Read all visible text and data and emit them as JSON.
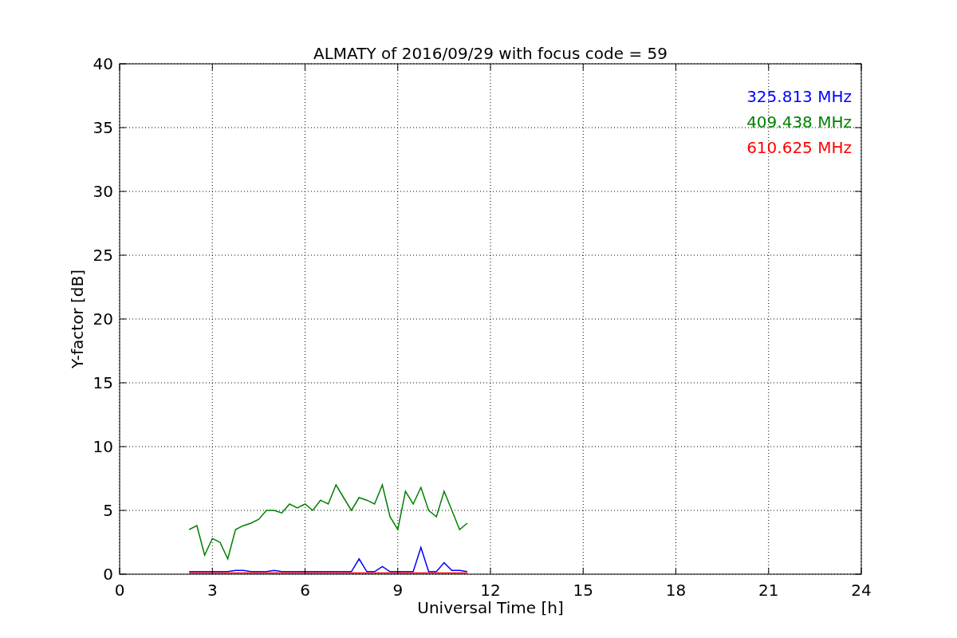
{
  "chart_data": {
    "type": "line",
    "title": "ALMATY of 2016/09/29 with focus code = 59",
    "xlabel": "Universal Time [h]",
    "ylabel": "Y-factor [dB]",
    "x": [
      2.25,
      2.5,
      2.75,
      3,
      3.25,
      3.5,
      3.75,
      4,
      4.25,
      4.5,
      4.75,
      5,
      5.25,
      5.5,
      5.75,
      6,
      6.25,
      6.5,
      6.75,
      7,
      7.25,
      7.5,
      7.75,
      8,
      8.25,
      8.5,
      8.75,
      9,
      9.25,
      9.5,
      9.75,
      10,
      10.25,
      10.5,
      10.75,
      11,
      11.25
    ],
    "series": [
      {
        "name": "325.813 MHz",
        "color": "#0000ff",
        "values": [
          0.2,
          0.2,
          0.2,
          0.2,
          0.2,
          0.2,
          0.3,
          0.3,
          0.2,
          0.2,
          0.2,
          0.3,
          0.2,
          0.2,
          0.2,
          0.2,
          0.2,
          0.2,
          0.2,
          0.2,
          0.2,
          0.2,
          1.2,
          0.2,
          0.2,
          0.6,
          0.2,
          0.2,
          0.2,
          0.2,
          2.1,
          0.2,
          0.2,
          0.9,
          0.3,
          0.3,
          0.2
        ]
      },
      {
        "name": "409.438 MHz",
        "color": "#008000",
        "values": [
          3.5,
          3.8,
          1.5,
          2.8,
          2.5,
          1.2,
          3.5,
          3.8,
          4.0,
          4.3,
          5.0,
          5.0,
          4.8,
          5.5,
          5.2,
          5.5,
          5.0,
          5.8,
          5.5,
          7.0,
          6.0,
          5.0,
          6.0,
          5.8,
          5.5,
          7.0,
          4.5,
          3.5,
          6.5,
          5.5,
          6.8,
          5.0,
          4.5,
          6.5,
          5.0,
          3.5,
          4.0
        ]
      },
      {
        "name": "610.625 MHz",
        "color": "#ff0000",
        "values": [
          0.1,
          0.1,
          0.1,
          0.1,
          0.1,
          0.1,
          0.1,
          0.1,
          0.1,
          0.1,
          0.1,
          0.1,
          0.1,
          0.1,
          0.1,
          0.1,
          0.1,
          0.1,
          0.1,
          0.1,
          0.1,
          0.1,
          0.1,
          0.1,
          0.1,
          0.1,
          0.1,
          0.1,
          0.1,
          0.1,
          0.1,
          0.1,
          0.1,
          0.1,
          0.1,
          0.1,
          0.1
        ]
      }
    ],
    "xlim": [
      0,
      24
    ],
    "ylim": [
      0,
      40
    ],
    "xticks": [
      0,
      3,
      6,
      9,
      12,
      15,
      18,
      21,
      24
    ],
    "yticks": [
      0,
      5,
      10,
      15,
      20,
      25,
      30,
      35,
      40
    ],
    "grid": true
  }
}
